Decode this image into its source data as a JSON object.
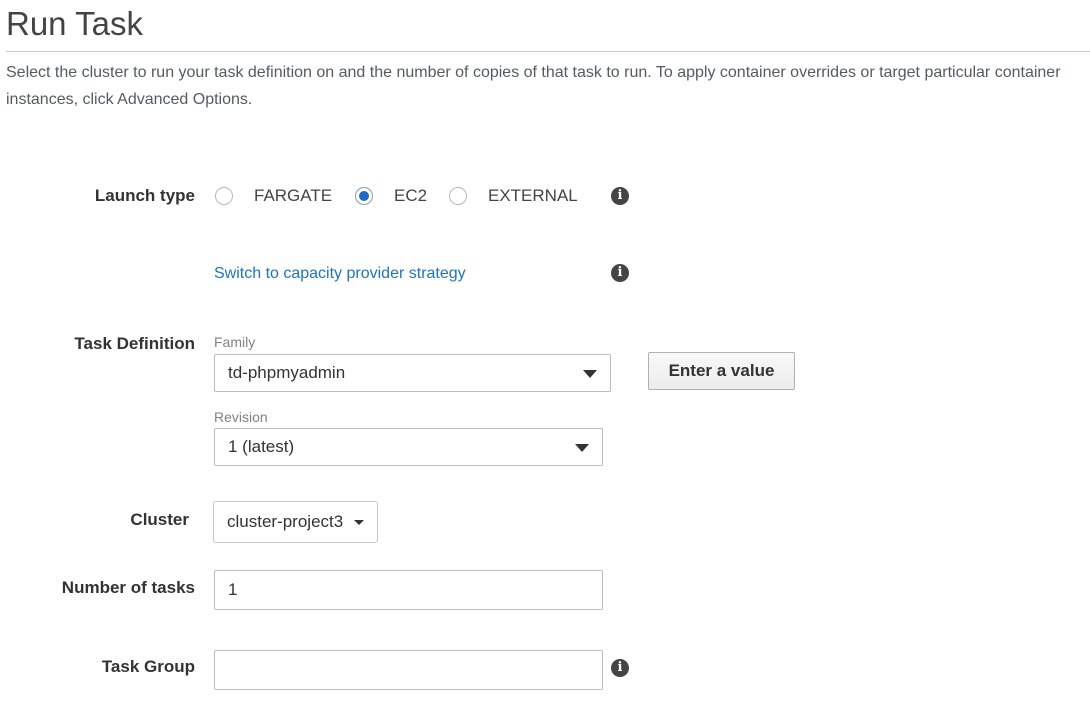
{
  "page": {
    "title": "Run Task",
    "description": "Select the cluster to run your task definition on and the number of copies of that task to run. To apply container overrides or target particular container instances, click Advanced Options."
  },
  "launch_type": {
    "label": "Launch type",
    "options": [
      {
        "label": "FARGATE",
        "checked": false
      },
      {
        "label": "EC2",
        "checked": true
      },
      {
        "label": "EXTERNAL",
        "checked": false
      }
    ],
    "switch_link": "Switch to capacity provider strategy"
  },
  "task_definition": {
    "label": "Task Definition",
    "family_label": "Family",
    "family_value": "td-phpmyadmin",
    "enter_value_button": "Enter a value",
    "revision_label": "Revision",
    "revision_value": "1 (latest)"
  },
  "cluster": {
    "label": "Cluster",
    "value": "cluster-project3"
  },
  "number_of_tasks": {
    "label": "Number of tasks",
    "value": "1"
  },
  "task_group": {
    "label": "Task Group",
    "value": ""
  },
  "colors": {
    "link": "#1f73c2",
    "radio_selected": "#1e6bc3",
    "text": "#444444"
  },
  "icons": {
    "info": "info-icon",
    "dropdown": "caret-down-icon"
  }
}
